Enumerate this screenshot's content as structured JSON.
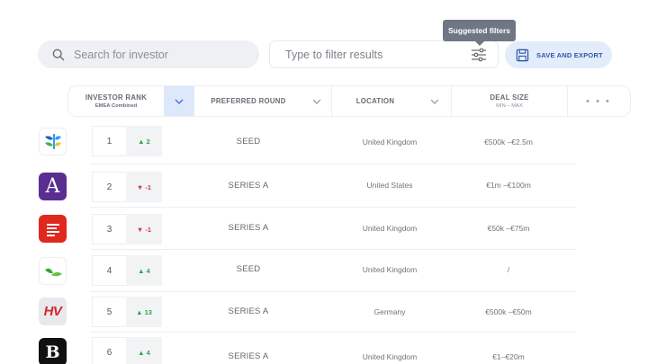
{
  "search": {
    "placeholder": "Search for investor"
  },
  "filter": {
    "placeholder": "Type to filter results",
    "tooltip": "Suggested filters"
  },
  "export": {
    "label": "SAVE AND EXPORT"
  },
  "columns": {
    "rank": {
      "label": "INVESTOR RANK",
      "sub": "EMEA Combined"
    },
    "round": {
      "label": "PREFERRED ROUND"
    },
    "location": {
      "label": "LOCATION"
    },
    "deal": {
      "label": "DEAL SIZE",
      "sub": "MIN – MAX"
    },
    "more": "• • •"
  },
  "rows": [
    {
      "rank": "1",
      "change": "▲ 2",
      "direction": "up",
      "round": "SEED",
      "location": "United Kingdom",
      "deal": "€500k –€2.5m",
      "logo": "blue-green-leaf-logo"
    },
    {
      "rank": "2",
      "change": "▼ -1",
      "direction": "down",
      "round": "SERIES A",
      "location": "United States",
      "deal": "€1m –€100m",
      "logo": "purple-a-logo",
      "logo_text": "A"
    },
    {
      "rank": "3",
      "change": "▼ -1",
      "direction": "down",
      "round": "SERIES A",
      "location": "United Kingdom",
      "deal": "€50k –€75m",
      "logo": "red-lines-logo"
    },
    {
      "rank": "4",
      "change": "▲ 4",
      "direction": "up",
      "round": "SEED",
      "location": "United Kingdom",
      "deal": "/",
      "logo": "green-sprout-logo"
    },
    {
      "rank": "5",
      "change": "▲ 13",
      "direction": "up",
      "round": "SERIES A",
      "location": "Germany",
      "deal": "€500k –€50m",
      "logo": "hv-logo",
      "logo_text": "HV"
    },
    {
      "rank": "6",
      "change": "▲ 4",
      "direction": "up",
      "round": "SERIES A",
      "location": "United Kingdom",
      "deal": "€1–€20m",
      "logo": "black-b-logo",
      "logo_text": "B"
    }
  ],
  "colors": {
    "accent": "#2f57a8",
    "up": "#2ea44f",
    "down": "#d23a3a"
  }
}
